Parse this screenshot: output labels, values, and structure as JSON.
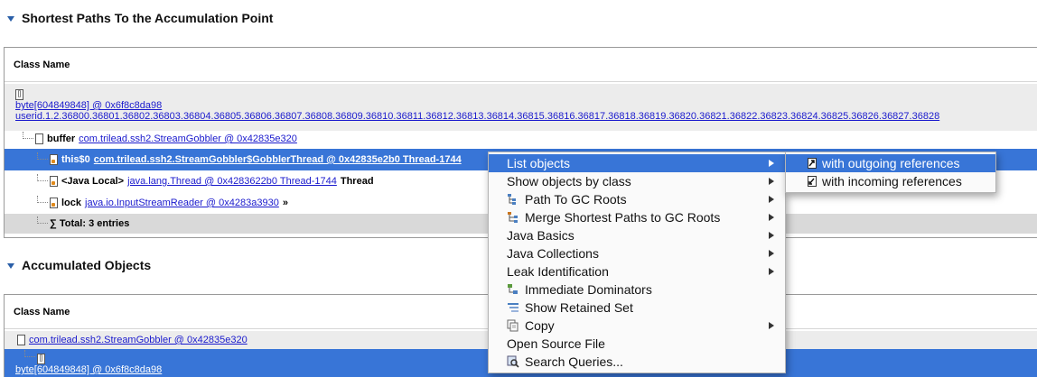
{
  "section1": {
    "title": "Shortest Paths To the Accumulation Point"
  },
  "section2": {
    "title": "Accumulated Objects"
  },
  "table1": {
    "column": "Class Name",
    "root_link": "byte[604849848] @ 0x6f8c8da98",
    "root_detail": "userid.1.2.36800.36801.36802.36803.36804.36805.36806.36807.36808.36809.36810.36811.36812.36813.36814.36815.36816.36817.36818.36819.36820.36821.36822.36823.36824.36825.36826.36827.36828",
    "rows": [
      {
        "label": "buffer",
        "link": "com.trilead.ssh2.StreamGobbler @ 0x42835e320",
        "suffix": ""
      },
      {
        "label": "this$0",
        "link": "com.trilead.ssh2.StreamGobbler$GobblerThread @ 0x42835e2b0 Thread-1744",
        "suffix": ""
      },
      {
        "label": "<Java Local>",
        "link": "java.lang.Thread @ 0x4283622b0 Thread-1744",
        "suffix": "Thread"
      },
      {
        "label": "lock",
        "link": "java.io.InputStreamReader @ 0x4283a3930",
        "suffix": "»"
      }
    ],
    "total": "∑ Total: 3 entries"
  },
  "table2": {
    "column": "Class Name",
    "rows": [
      {
        "link": "com.trilead.ssh2.StreamGobbler @ 0x42835e320"
      },
      {
        "link": "byte[604849848] @ 0x6f8c8da98"
      }
    ]
  },
  "context_menu": {
    "items": [
      {
        "label": "List objects",
        "icon": "",
        "submenu": true
      },
      {
        "label": "Show objects by class",
        "icon": "",
        "submenu": true
      },
      {
        "label": "Path To GC Roots",
        "icon": "path-icon",
        "submenu": true
      },
      {
        "label": "Merge Shortest Paths to GC Roots",
        "icon": "merge-icon",
        "submenu": true
      },
      {
        "label": "Java Basics",
        "icon": "",
        "submenu": true
      },
      {
        "label": "Java Collections",
        "icon": "",
        "submenu": true
      },
      {
        "label": "Leak Identification",
        "icon": "",
        "submenu": true
      },
      {
        "label": "Immediate Dominators",
        "icon": "dominator-icon",
        "submenu": false
      },
      {
        "label": "Show Retained Set",
        "icon": "retained-icon",
        "submenu": false
      },
      {
        "label": "Copy",
        "icon": "copy-icon",
        "submenu": true
      },
      {
        "label": "Open Source File",
        "icon": "",
        "submenu": false
      },
      {
        "label": "Search Queries...",
        "icon": "search-icon",
        "submenu": false
      }
    ]
  },
  "submenu": {
    "items": [
      {
        "label": "with outgoing references"
      },
      {
        "label": "with incoming references"
      }
    ]
  },
  "colors": {
    "selection": "#3875d7",
    "link": "#1a1acd"
  }
}
